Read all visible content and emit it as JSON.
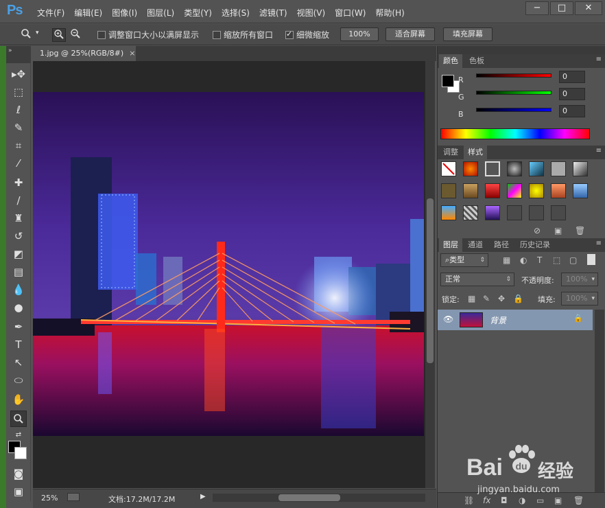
{
  "app": {
    "logo": "Ps"
  },
  "menu": [
    "文件(F)",
    "编辑(E)",
    "图像(I)",
    "图层(L)",
    "类型(Y)",
    "选择(S)",
    "滤镜(T)",
    "视图(V)",
    "窗口(W)",
    "帮助(H)"
  ],
  "window_controls": {
    "minimize": "−",
    "maximize": "□",
    "close": "✕"
  },
  "options": {
    "resize_windows": "调整窗口大小以满屏显示",
    "zoom_all": "缩放所有窗口",
    "scrubby_zoom": "细微缩放",
    "scrubby_checked": true,
    "btn_100": "100%",
    "btn_fit": "适合屏幕",
    "btn_fill": "填充屏幕"
  },
  "document": {
    "tab_title": "1.jpg @ 25%(RGB/8#)",
    "tab_close": "×",
    "zoom": "25%",
    "doc_size": "文档:17.2M/17.2M"
  },
  "color_panel": {
    "tabs": [
      "颜色",
      "色板"
    ],
    "r_label": "R",
    "g_label": "G",
    "b_label": "B",
    "r_value": "0",
    "g_value": "0",
    "b_value": "0"
  },
  "styles_panel": {
    "tabs": [
      "调整",
      "样式"
    ]
  },
  "layers_panel": {
    "tabs": [
      "图层",
      "通道",
      "路径",
      "历史记录"
    ],
    "filter_kind": "类型",
    "blend_mode": "正常",
    "opacity_label": "不透明度:",
    "opacity_value": "100%",
    "lock_label": "锁定:",
    "fill_label": "填充:",
    "fill_value": "100%",
    "layer_name": "背景"
  },
  "watermark": {
    "brand": "Bai",
    "brand_cn": "经验",
    "url": "jingyan.baidu.com"
  },
  "colors": {
    "ui_bg": "#535353",
    "panel_dark": "#3d3d3d",
    "layer_selected": "#8497b0",
    "logo_blue": "#4aa0e6"
  }
}
